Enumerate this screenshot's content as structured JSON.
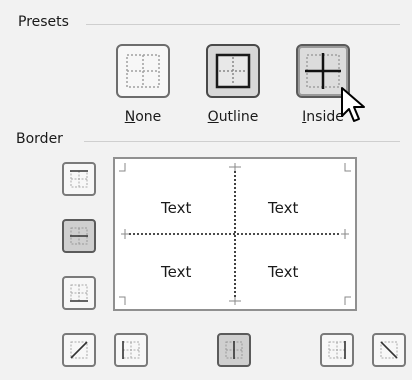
{
  "presets": {
    "title": "Presets",
    "items": [
      {
        "label_mnemonic": "N",
        "label_rest": "one"
      },
      {
        "label_mnemonic": "O",
        "label_rest": "utline"
      },
      {
        "label_mnemonic": "I",
        "label_rest": "nside"
      }
    ]
  },
  "border": {
    "title": "Border",
    "preview_cells": [
      "Text",
      "Text",
      "Text",
      "Text"
    ]
  }
}
